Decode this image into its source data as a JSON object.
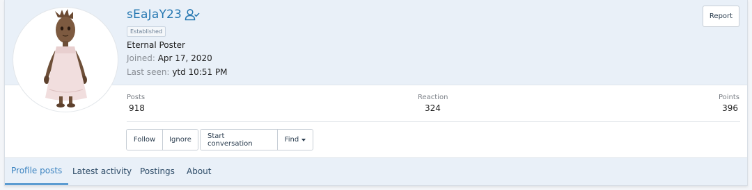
{
  "profile": {
    "username": "sEaJaY23",
    "badge": "Established",
    "user_title": "Eternal Poster",
    "joined_label": "Joined:",
    "joined_value": "Apr 17, 2020",
    "last_seen_label": "Last seen:",
    "last_seen_value": "ytd 10:51 PM",
    "avatar_icon": "avatar",
    "verified_icon": "user-check-icon"
  },
  "actions": {
    "report_label": "Report",
    "follow_label": "Follow",
    "ignore_label": "Ignore",
    "start_conversation_label": "Start conversation",
    "find_label": "Find"
  },
  "stats": [
    {
      "label": "Posts",
      "value": "918"
    },
    {
      "label": "Reaction",
      "value": "324"
    },
    {
      "label": "Points",
      "value": "396"
    }
  ],
  "tabs": [
    {
      "label": "Profile posts",
      "active": true
    },
    {
      "label": "Latest activity",
      "active": false
    },
    {
      "label": "Postings",
      "active": false
    },
    {
      "label": "About",
      "active": false
    }
  ],
  "colors": {
    "accent": "#2577b1",
    "active_tab": "#3b83c0",
    "header_band": "#e9f0f8"
  }
}
